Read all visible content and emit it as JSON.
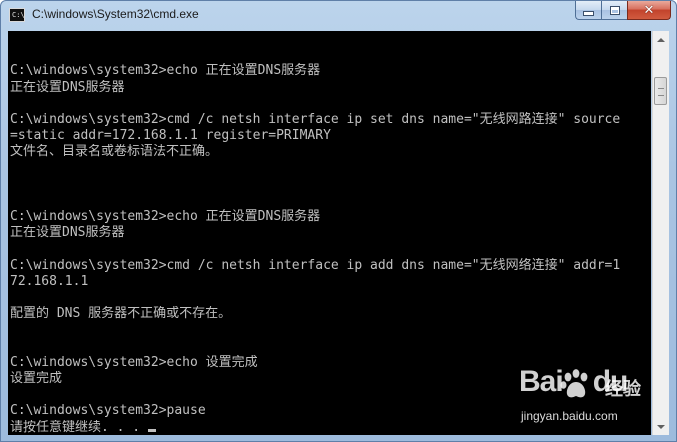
{
  "window": {
    "title": "C:\\windows\\System32\\cmd.exe",
    "app_icon_text": "C:\\",
    "minimize_glyph": "minimize-icon",
    "maximize_glyph": "maximize-icon",
    "close_label": "✕"
  },
  "console": {
    "lines": [
      "",
      "",
      "C:\\windows\\system32>echo 正在设置DNS服务器",
      "正在设置DNS服务器",
      "",
      "C:\\windows\\system32>cmd /c netsh interface ip set dns name=\"无线网路连接\" source",
      "=static addr=172.168.1.1 register=PRIMARY",
      "文件名、目录名或卷标语法不正确。",
      "",
      "",
      "",
      "C:\\windows\\system32>echo 正在设置DNS服务器",
      "正在设置DNS服务器",
      "",
      "C:\\windows\\system32>cmd /c netsh interface ip add dns name=\"无线网络连接\" addr=1",
      "72.168.1.1",
      "",
      "配置的 DNS 服务器不正确或不存在。",
      "",
      "",
      "C:\\windows\\system32>echo 设置完成",
      "设置完成",
      "",
      "C:\\windows\\system32>pause",
      "请按任意键继续. . . "
    ],
    "text_color": "#c0c0c0",
    "background": "#000000"
  },
  "scrollbar": {
    "up_icon": "arrow-up-icon",
    "down_icon": "arrow-down-icon",
    "position_fraction": 0.06
  },
  "watermark": {
    "logo_text_a": "Bai",
    "logo_text_b": "du",
    "product": "经验",
    "url": "jingyan.baidu.com"
  },
  "colors": {
    "title_bar": "#a9c4e2",
    "close_button": "#c2432c",
    "console_bg": "#000000",
    "console_fg": "#c0c0c0"
  }
}
